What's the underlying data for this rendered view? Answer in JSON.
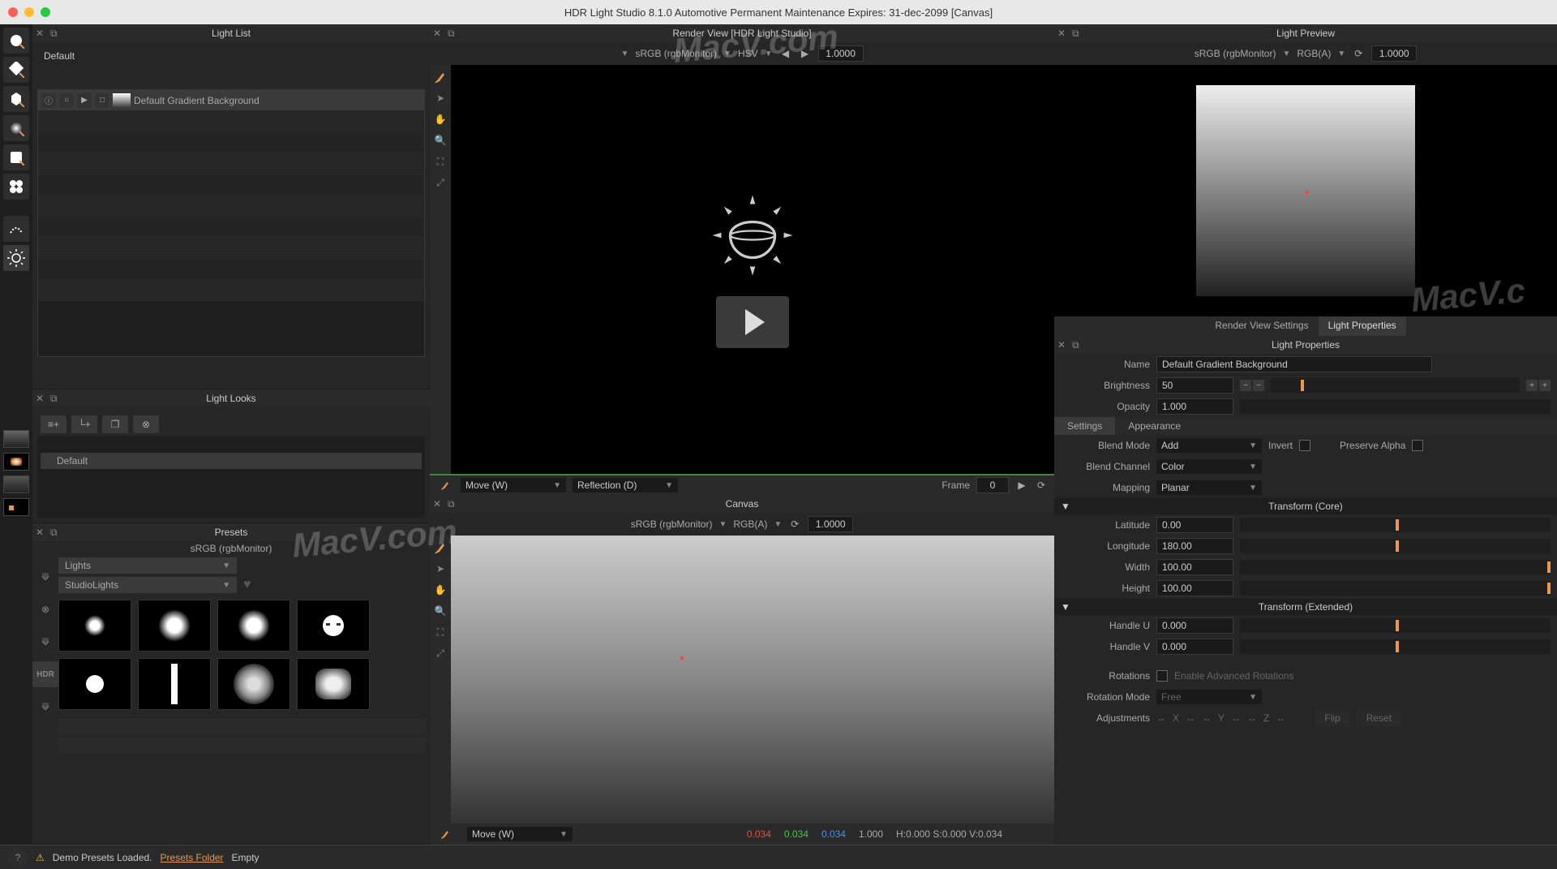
{
  "title": "HDR Light Studio 8.1.0   Automotive Permanent Maintenance Expires: 31-dec-2099 [Canvas]",
  "panels": {
    "light_list": {
      "title": "Light List",
      "scene": "Default",
      "item": "Default Gradient Background"
    },
    "light_looks": {
      "title": "Light Looks",
      "item": "Default"
    },
    "presets": {
      "title": "Presets",
      "colorspace": "sRGB (rgbMonitor)",
      "category": "Lights",
      "subcategory": "StudioLights"
    },
    "render_view": {
      "title": "Render View [HDR Light Studio]",
      "colorspace": "sRGB (rgbMonitor)",
      "mode": "HSV",
      "exposure": "1.0000"
    },
    "canvas": {
      "title": "Canvas",
      "colorspace": "sRGB (rgbMonitor)",
      "channels": "RGB(A)",
      "exposure": "1.0000"
    },
    "light_preview": {
      "title": "Light Preview",
      "colorspace": "sRGB (rgbMonitor)",
      "channels": "RGB(A)",
      "exposure": "1.0000"
    }
  },
  "timeline": {
    "tool": "Move (W)",
    "mode": "Reflection (D)",
    "frame_label": "Frame",
    "frame": "0"
  },
  "canvas_footer": {
    "tool": "Move (W)",
    "r": "0.034",
    "g": "0.034",
    "b": "0.034",
    "a": "1.000",
    "hsv": "H:0.000 S:0.000 V:0.034"
  },
  "tabs": {
    "rv_settings": "Render View Settings",
    "light_props": "Light Properties"
  },
  "light_props": {
    "title": "Light Properties",
    "name_label": "Name",
    "name": "Default Gradient Background",
    "brightness_label": "Brightness",
    "brightness": "50",
    "opacity_label": "Opacity",
    "opacity": "1.000",
    "tab_settings": "Settings",
    "tab_appearance": "Appearance",
    "blend_mode_label": "Blend Mode",
    "blend_mode": "Add",
    "invert_label": "Invert",
    "preserve_alpha_label": "Preserve Alpha",
    "blend_channel_label": "Blend Channel",
    "blend_channel": "Color",
    "mapping_label": "Mapping",
    "mapping": "Planar",
    "section_core": "Transform (Core)",
    "latitude_label": "Latitude",
    "latitude": "0.00",
    "longitude_label": "Longitude",
    "longitude": "180.00",
    "width_label": "Width",
    "width": "100.00",
    "height_label": "Height",
    "height": "100.00",
    "section_ext": "Transform (Extended)",
    "handle_u_label": "Handle U",
    "handle_u": "0.000",
    "handle_v_label": "Handle V",
    "handle_v": "0.000",
    "rotations_label": "Rotations",
    "enable_rot_label": "Enable Advanced Rotations",
    "rotation_mode_label": "Rotation Mode",
    "rotation_mode": "Free",
    "adjustments_label": "Adjustments",
    "axis_x": "X",
    "axis_y": "Y",
    "axis_z": "Z",
    "flip_label": "Flip",
    "reset_label": "Reset"
  },
  "status": {
    "msg1": "Demo Presets Loaded.",
    "link": "Presets Folder",
    "msg2": "Empty"
  }
}
